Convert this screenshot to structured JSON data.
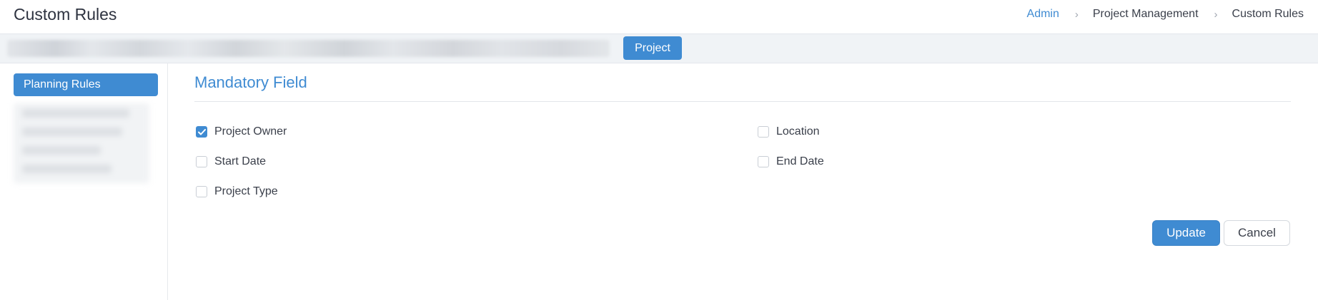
{
  "header": {
    "title": "Custom Rules",
    "breadcrumb": [
      {
        "label": "Admin",
        "link": true
      },
      {
        "label": "Project Management",
        "link": false
      },
      {
        "label": "Custom Rules",
        "link": false
      }
    ],
    "separator": "›"
  },
  "tabs": {
    "active_label": "Project"
  },
  "sidebar": {
    "active_item": "Planning Rules"
  },
  "section": {
    "title": "Mandatory Field",
    "fields": [
      {
        "label": "Project Owner",
        "checked": true
      },
      {
        "label": "Location",
        "checked": false
      },
      {
        "label": "Start Date",
        "checked": false
      },
      {
        "label": "End Date",
        "checked": false
      },
      {
        "label": "Project Type",
        "checked": false
      }
    ]
  },
  "actions": {
    "update_label": "Update",
    "cancel_label": "Cancel"
  },
  "colors": {
    "accent": "#3f8bd2",
    "tabbar_bg": "#f0f3f6"
  }
}
